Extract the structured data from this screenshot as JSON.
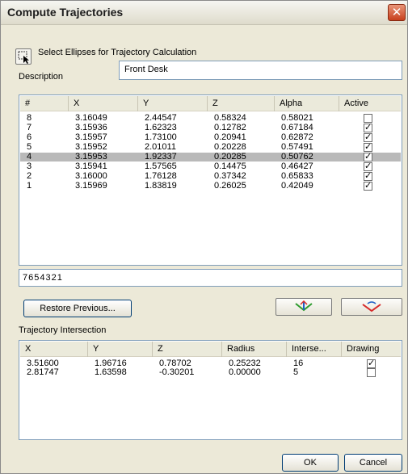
{
  "window": {
    "title": "Compute Trajectories",
    "close_glyph": "✕"
  },
  "select": {
    "label": "Select Ellipses for Trajectory Calculation",
    "icon": "select-arrow-icon"
  },
  "description": {
    "label": "Description",
    "value": "Front Desk"
  },
  "ellipses": {
    "columns": [
      "#",
      "X",
      "Y",
      "Z",
      "Alpha",
      "Active"
    ],
    "rows": [
      {
        "num": "8",
        "x": "3.16049",
        "y": "2.44547",
        "z": "0.58324",
        "alpha": "0.58021",
        "active": false,
        "selected": false
      },
      {
        "num": "7",
        "x": "3.15936",
        "y": "1.62323",
        "z": "0.12782",
        "alpha": "0.67184",
        "active": true,
        "selected": false
      },
      {
        "num": "6",
        "x": "3.15957",
        "y": "1.73100",
        "z": "0.20941",
        "alpha": "0.62872",
        "active": true,
        "selected": false
      },
      {
        "num": "5",
        "x": "3.15952",
        "y": "2.01011",
        "z": "0.20228",
        "alpha": "0.57491",
        "active": true,
        "selected": false
      },
      {
        "num": "4",
        "x": "3.15953",
        "y": "1.92337",
        "z": "0.20285",
        "alpha": "0.50762",
        "active": true,
        "selected": true
      },
      {
        "num": "3",
        "x": "3.15941",
        "y": "1.57565",
        "z": "0.14475",
        "alpha": "0.46427",
        "active": true,
        "selected": false
      },
      {
        "num": "2",
        "x": "3.16000",
        "y": "1.76128",
        "z": "0.37342",
        "alpha": "0.65833",
        "active": true,
        "selected": false
      },
      {
        "num": "1",
        "x": "3.15969",
        "y": "1.83819",
        "z": "0.26025",
        "alpha": "0.42049",
        "active": true,
        "selected": false
      }
    ]
  },
  "ellipse_list_value": "7654321",
  "restore_button": "Restore Previous...",
  "trajectory_buttons": {
    "compute_icon": "trajectory-compute-icon",
    "clear_icon": "trajectory-clear-icon"
  },
  "intersection": {
    "label": "Trajectory Intersection",
    "columns": [
      "X",
      "Y",
      "Z",
      "Radius",
      "Interse...",
      "Drawing"
    ],
    "rows": [
      {
        "x": "3.51600",
        "y": "1.96716",
        "z": "0.78702",
        "radius": "0.25232",
        "inter": "16",
        "drawing": true
      },
      {
        "x": "2.81747",
        "y": "1.63598",
        "z": "-0.30201",
        "radius": "0.00000",
        "inter": "5",
        "drawing": false
      }
    ]
  },
  "footer": {
    "ok": "OK",
    "cancel": "Cancel"
  },
  "colors": {
    "face": "#ece9d8",
    "selected_row": "#b9b9b9",
    "compute_arrow": "#2e9b2e",
    "clear_arrow": "#d62a2a"
  }
}
